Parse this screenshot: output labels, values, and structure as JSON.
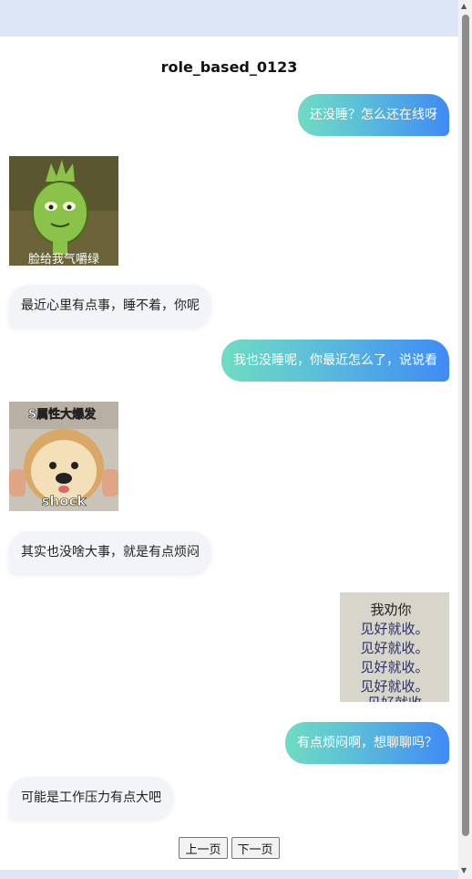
{
  "title": "role_based_0123",
  "messages": [
    {
      "side": "right",
      "type": "text",
      "text": "还没睡？怎么还在线呀"
    },
    {
      "side": "left",
      "type": "image",
      "caption": "脸给我气嚼绿",
      "icon": "green-sprout-meme"
    },
    {
      "side": "left",
      "type": "text",
      "text": "最近心里有点事，睡不着，你呢"
    },
    {
      "side": "right",
      "type": "text",
      "text": "我也没睡呢，你最近怎么了，说说看"
    },
    {
      "side": "left",
      "type": "image",
      "caption_top": "S属性大爆发",
      "caption_bottom": "shock",
      "icon": "bread-dog-meme"
    },
    {
      "side": "left",
      "type": "text",
      "text": "其实也没啥大事，就是有点烦闷"
    },
    {
      "side": "right",
      "type": "image",
      "lines": [
        "我劝你",
        "见好就收。",
        "见好就收。",
        "见好就收。",
        "见好就收。",
        "见好就收"
      ],
      "icon": "handwriting-note-meme"
    },
    {
      "side": "right",
      "type": "text",
      "text": "有点烦闷啊，想聊聊吗？"
    },
    {
      "side": "left",
      "type": "text",
      "text": "可能是工作压力有点大吧"
    }
  ],
  "pager": {
    "prev": "上一页",
    "next": "下一页"
  },
  "colors": {
    "gradient_start": "#6fdcc2",
    "gradient_end": "#3f8af5",
    "left_bubble": "#f2f4f8"
  }
}
